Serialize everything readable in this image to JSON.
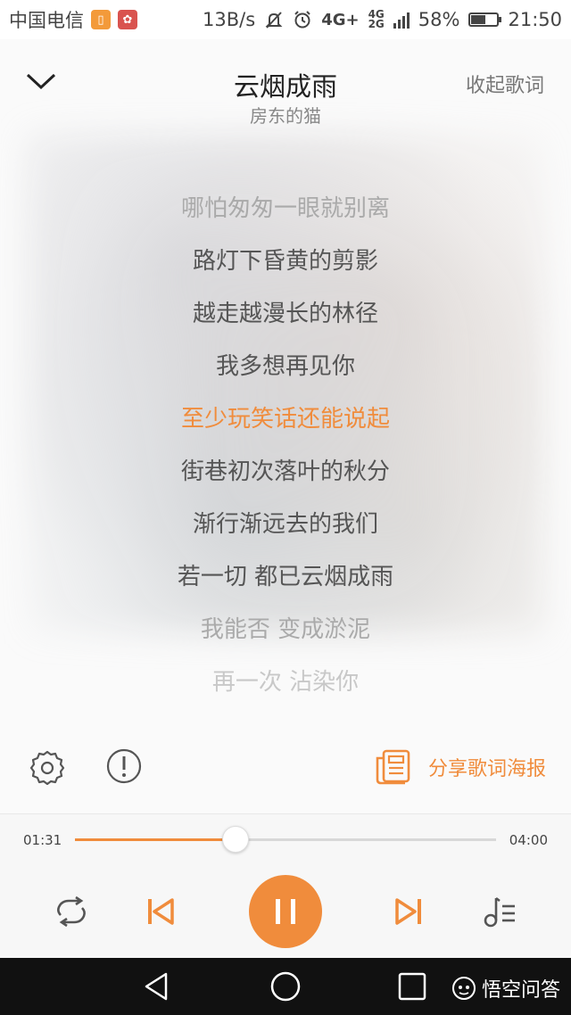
{
  "status_bar": {
    "carrier": "中国电信",
    "speed": "13B/s",
    "network_top": "4G+",
    "network_small_top": "4G",
    "network_small_bottom": "2G",
    "battery": "58%",
    "battery_level": 0.58,
    "time": "21:50"
  },
  "header": {
    "title": "云烟成雨",
    "artist": "房东的猫",
    "fold_lyrics_label": "收起歌词"
  },
  "lyrics": [
    {
      "text": "哪怕匆匆一眼就别离",
      "state": "fade1"
    },
    {
      "text": "路灯下昏黄的剪影",
      "state": "normal"
    },
    {
      "text": "越走越漫长的林径",
      "state": "normal"
    },
    {
      "text": "我多想再见你",
      "state": "normal"
    },
    {
      "text": "至少玩笑话还能说起",
      "state": "active"
    },
    {
      "text": "街巷初次落叶的秋分",
      "state": "normal"
    },
    {
      "text": "渐行渐远去的我们",
      "state": "normal"
    },
    {
      "text": "若一切 都已云烟成雨",
      "state": "normal"
    },
    {
      "text": "我能否 变成淤泥",
      "state": "fade1"
    },
    {
      "text": "再一次 沾染你",
      "state": "fade2"
    }
  ],
  "tools": {
    "share_label": "分享歌词海报"
  },
  "player": {
    "elapsed": "01:31",
    "duration": "04:00",
    "progress": 0.3792
  },
  "watermark": "悟空问答",
  "colors": {
    "accent": "#f08c3c"
  }
}
